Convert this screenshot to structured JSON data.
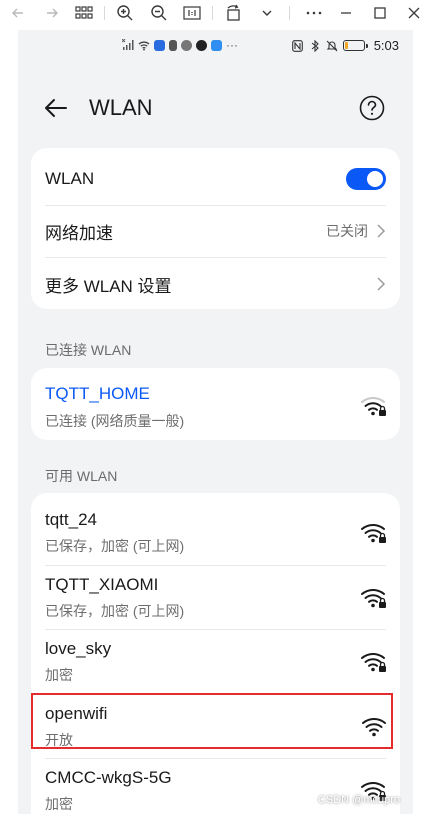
{
  "viewer": {
    "icons": [
      "arrow-left-icon",
      "arrow-right-icon",
      "grid-icon",
      "zoom-in-icon",
      "zoom-out-icon",
      "fit-icon",
      "rotate-icon",
      "chevron-down-icon",
      "minimize-icon",
      "maximize-icon",
      "close-icon"
    ]
  },
  "status_bar": {
    "time": "5:03",
    "battery_color": "#f5a623",
    "battery_level": 0.2
  },
  "header": {
    "title": "WLAN"
  },
  "settings": {
    "wlan_label": "WLAN",
    "wlan_enabled": true,
    "accel_label": "网络加速",
    "accel_value": "已关闭",
    "more_label": "更多 WLAN 设置"
  },
  "connected": {
    "section_label": "已连接 WLAN",
    "name": "TQTT_HOME",
    "status": "已连接 (网络质量一般)"
  },
  "available": {
    "section_label": "可用 WLAN",
    "networks": [
      {
        "name": "tqtt_24",
        "status": "已保存，加密 (可上网)",
        "locked": true
      },
      {
        "name": "TQTT_XIAOMI",
        "status": "已保存，加密 (可上网)",
        "locked": true
      },
      {
        "name": "love_sky",
        "status": "加密",
        "locked": true
      },
      {
        "name": "openwifi",
        "status": "开放",
        "locked": false
      },
      {
        "name": "CMCC-wkgS-5G",
        "status": "加密",
        "locked": true
      }
    ]
  },
  "watermark": "CSDN @mcupro",
  "colors": {
    "accent": "#0a59f7",
    "highlight": "#e52b2b",
    "background": "#f1f3f5"
  }
}
